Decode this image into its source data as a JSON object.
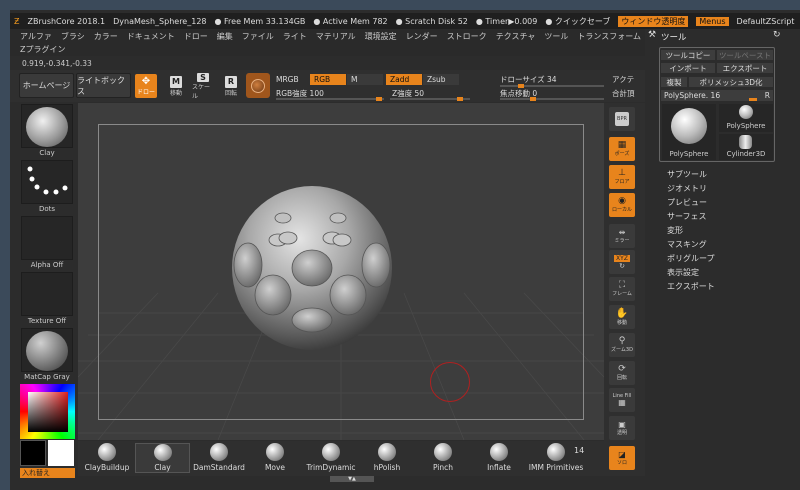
{
  "titlebar": {
    "app": "ZBrushCore 2018.1",
    "doc": "DynaMesh_Sphere_128",
    "free_mem": "● Free Mem 33.134GB",
    "active_mem": "● Active Mem 782",
    "scratch": "● Scratch Disk 52",
    "timer": "● Timer▶0.009",
    "quicksave": "● クイックセーブ",
    "transparency": "ウィンドウ透明度",
    "menus": "Menus",
    "script": "DefaultZScript",
    "tool_title": "ツール"
  },
  "menubar": [
    "アルファ",
    "ブラシ",
    "カラー",
    "ドキュメント",
    "ドロー",
    "編集",
    "ファイル",
    "ライト",
    "マテリアル",
    "環境設定",
    "レンダー",
    "ストローク",
    "テクスチャ",
    "ツール",
    "トランスフォーム"
  ],
  "submenu": "Zプラグイン",
  "coords": "0.919,-0.341,-0.33",
  "toolbar": {
    "home": "ホームページ",
    "lightbox": "ライトボックス",
    "draw": "ドロー",
    "move": "移動",
    "scale": "スケール",
    "rotate": "回転",
    "mrgb": "MRGB",
    "rgb": "RGB",
    "m": "M",
    "zadd": "Zadd",
    "zsub": "Zsub",
    "rgb_intensity": "RGB強度 100",
    "z_intensity": "Z強度 50",
    "draw_size": "ドローサイズ 34",
    "focal_shift": "焦点移動 0",
    "act": "アクテ",
    "total": "合計頂"
  },
  "leftshelf": {
    "brush": "Clay",
    "stroke": "Dots",
    "alpha": "Alpha Off",
    "texture": "Texture Off",
    "material": "MatCap Gray",
    "switch": "入れ替え"
  },
  "rightshelf": [
    "ギクセル",
    "ポーズ",
    "フロア",
    "ローカル",
    "ミラー",
    "XYZ",
    "フレーム",
    "移動",
    "ズーム3D",
    "回転",
    "Line Fill",
    "透明",
    "ソロ"
  ],
  "toolpanel": {
    "copy": "ツールコピー",
    "paste": "ツールペースト",
    "import": "インポート",
    "export": "エクスポート",
    "clone": "複製",
    "polymesh": "ポリメッシュ3D化",
    "current": "PolySphere. 16",
    "r": "R",
    "thumb1": "PolySphere",
    "thumb2": "PolySphere",
    "thumb3": "Cylinder3D",
    "menu": [
      "サブツール",
      "ジオメトリ",
      "プレビュー",
      "サーフェス",
      "変形",
      "マスキング",
      "ポリグループ",
      "表示設定",
      "エクスポート"
    ]
  },
  "brushes": [
    "ClayBuildup",
    "Clay",
    "DamStandard",
    "Move",
    "TrimDynamic",
    "hPolish",
    "Pinch",
    "Inflate",
    "IMM Primitives"
  ],
  "brush_count": "14"
}
